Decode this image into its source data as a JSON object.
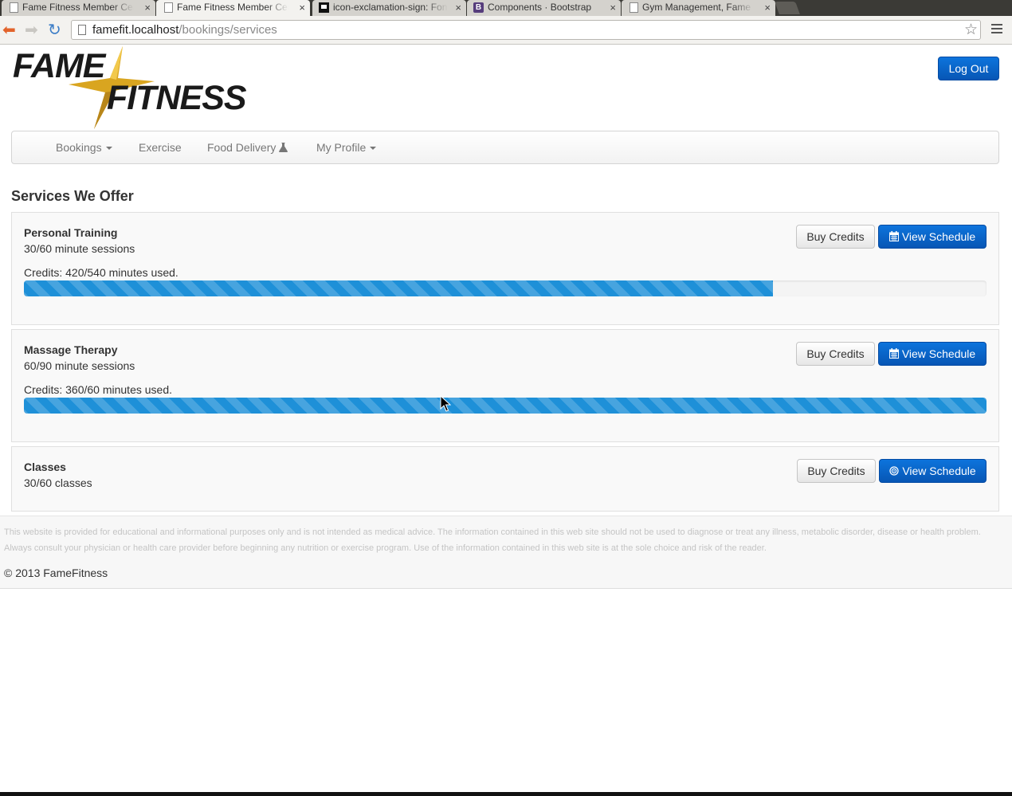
{
  "browser": {
    "tabs": [
      {
        "title": "Fame Fitness Member Cen",
        "favicon": "page-icon",
        "active": false
      },
      {
        "title": "Fame Fitness Member Cen",
        "favicon": "page-icon",
        "active": true
      },
      {
        "title": "icon-exclamation-sign: Fon",
        "favicon": "flag-icon",
        "active": false
      },
      {
        "title": "Components · Bootstrap",
        "favicon": "bootstrap-icon",
        "active": false
      },
      {
        "title": "Gym Management, Fame Fi",
        "favicon": "page-icon",
        "active": false
      }
    ],
    "close_glyph": "×",
    "url_host": "famefit.localhost",
    "url_path": "/bookings/services"
  },
  "brand": {
    "line1": "FAME",
    "line2": "FITNESS"
  },
  "header": {
    "logout_label": "Log Out"
  },
  "nav": {
    "items": [
      {
        "label": "Bookings",
        "dropdown": true
      },
      {
        "label": "Exercise",
        "dropdown": false
      },
      {
        "label": "Food Delivery",
        "icon": "flask-icon"
      },
      {
        "label": "My Profile",
        "dropdown": true
      }
    ]
  },
  "main": {
    "title": "Services We Offer",
    "services": [
      {
        "name": "Personal Training",
        "description": "30/60 minute sessions",
        "credits_text": "Credits: 420/540 minutes used.",
        "progress": 0.778,
        "buy_label": "Buy Credits",
        "schedule_label": "View Schedule",
        "schedule_icon": "calendar-icon"
      },
      {
        "name": "Massage Therapy",
        "description": "60/90 minute sessions",
        "credits_text": "Credits: 360/60 minutes used.",
        "progress": 1.0,
        "buy_label": "Buy Credits",
        "schedule_label": "View Schedule",
        "schedule_icon": "calendar-icon"
      },
      {
        "name": "Classes",
        "description": "30/60 classes",
        "buy_label": "Buy Credits",
        "schedule_label": "View Schedule",
        "schedule_icon": "target-icon"
      }
    ]
  },
  "footer": {
    "disclaimer": "This website is provided for educational and informational purposes only and is not intended as medical advice. The information contained in this web site should not be used to diagnose or treat any illness, metabolic disorder, disease or health problem. Always consult your physician or health care provider before beginning any nutrition or exercise program. Use of the information contained in this web site is at the sole choice and risk of the reader.",
    "copyright": "© 2013 FameFitness"
  },
  "colors": {
    "primary": "#0756b5",
    "progress": "#1e90d8",
    "brand_gold": "#d9a520"
  }
}
